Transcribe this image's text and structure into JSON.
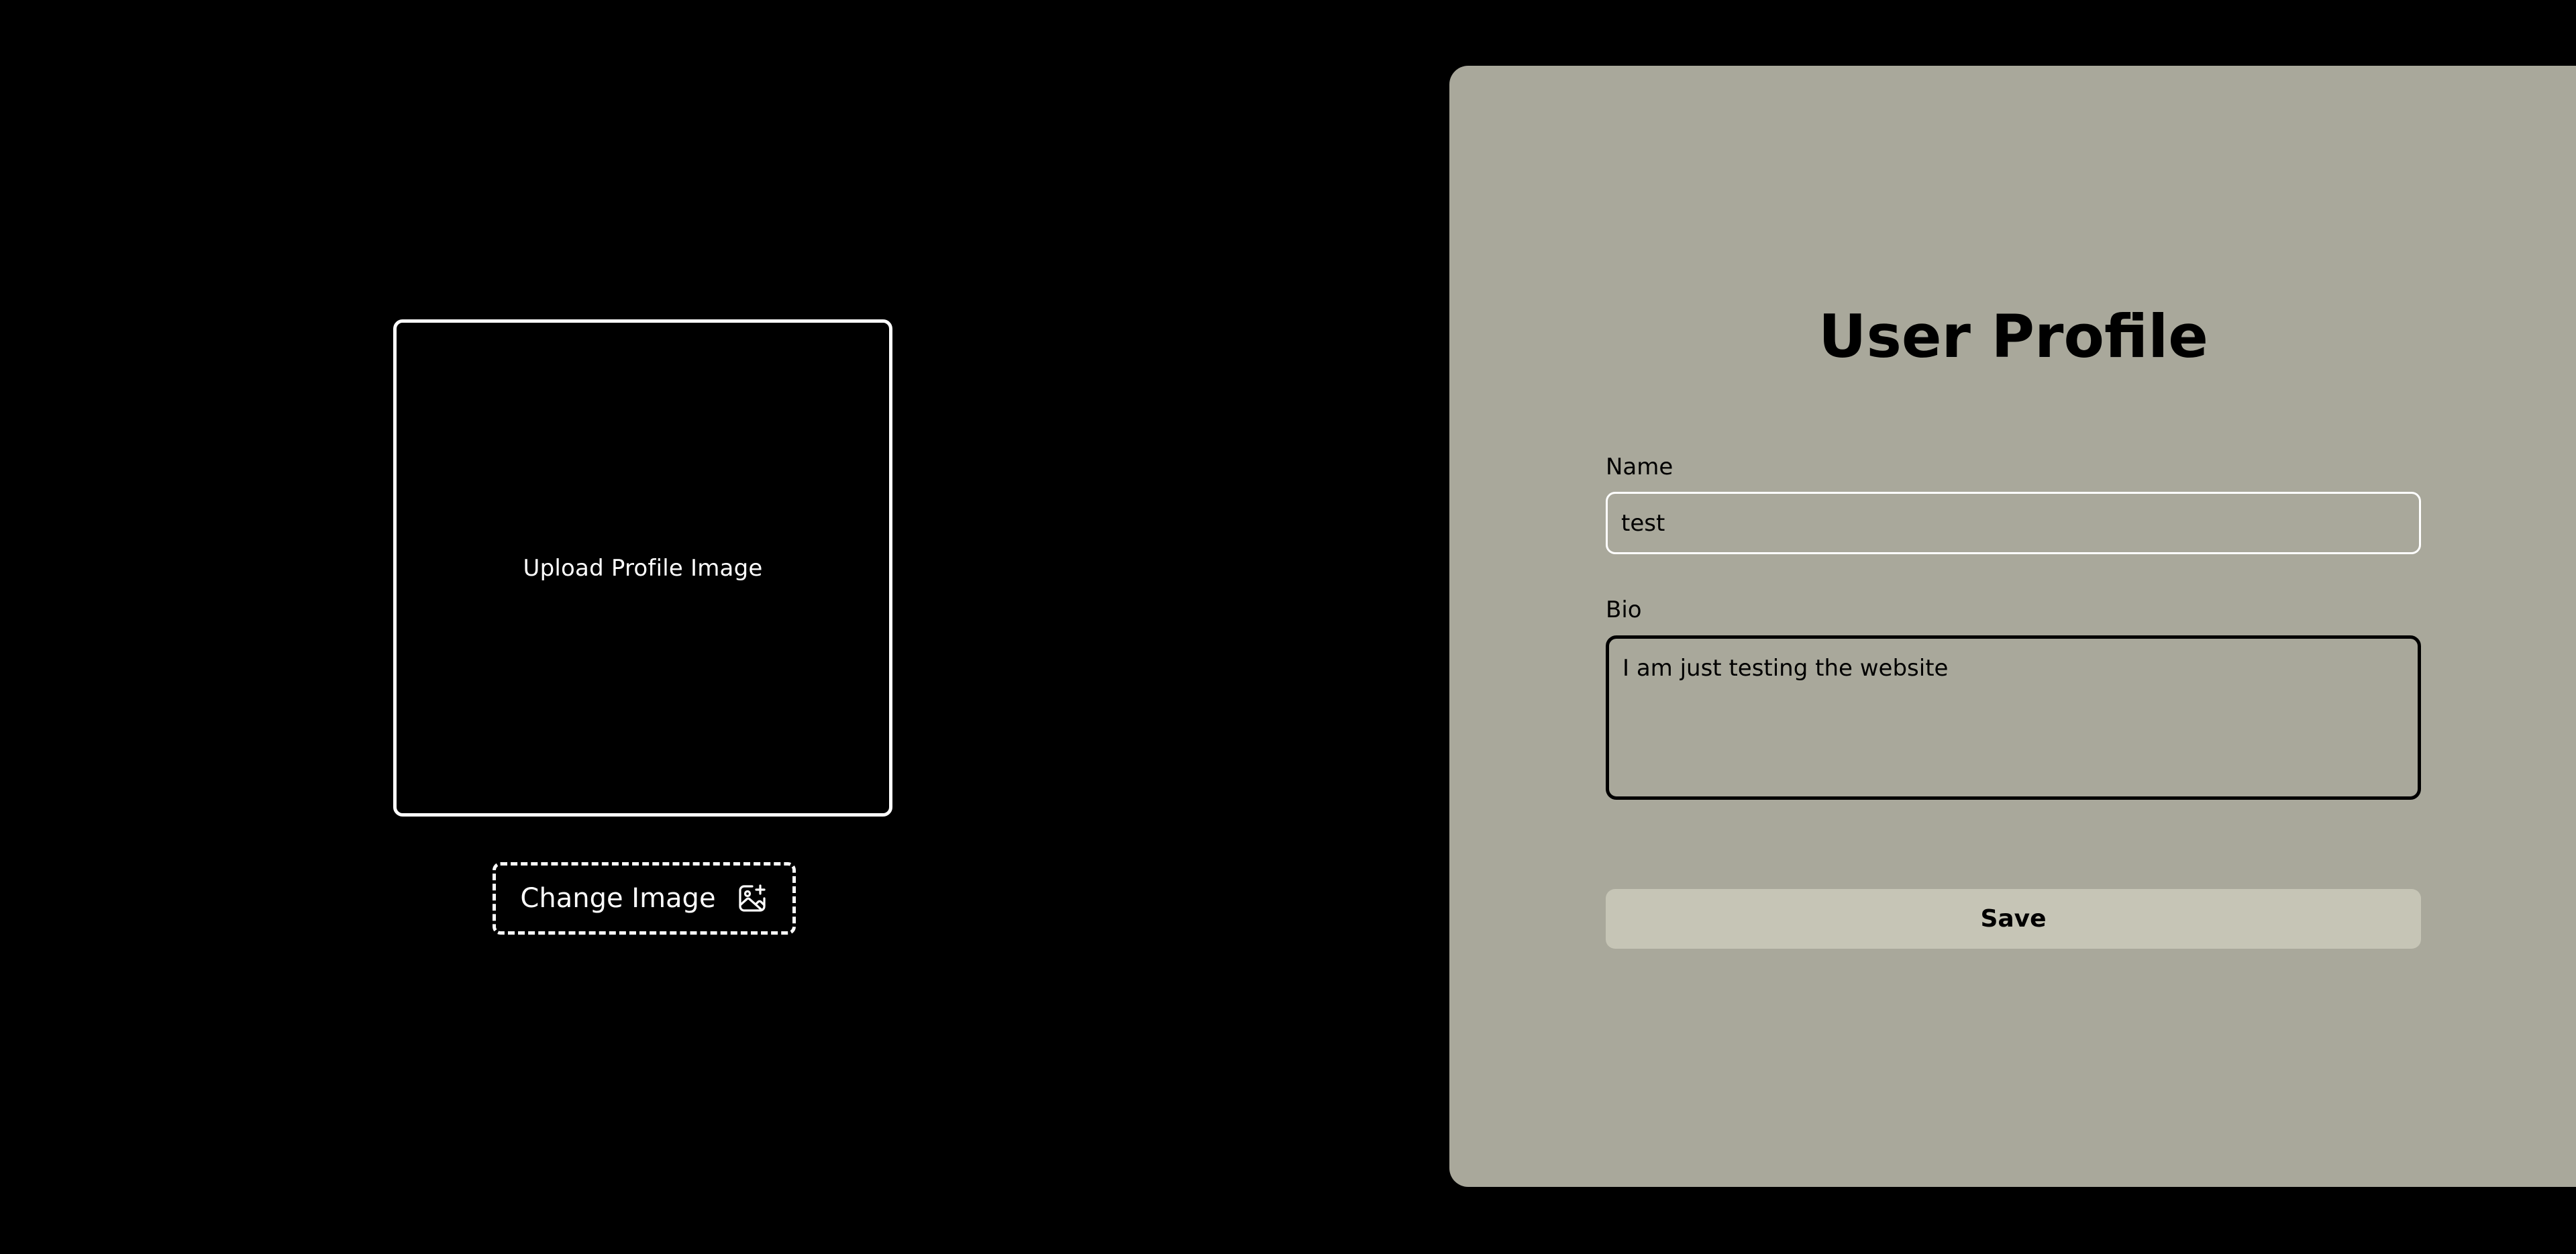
{
  "upload": {
    "label": "Upload Profile Image",
    "change_button_label": "Change Image",
    "change_icon": "image-sparkle-icon"
  },
  "profile": {
    "title": "User Profile",
    "name_label": "Name",
    "name_value": "test",
    "bio_label": "Bio",
    "bio_value": "I am just testing the website",
    "save_label": "Save"
  },
  "colors": {
    "page_background": "#000000",
    "card_background": "#a9a89b",
    "save_button": "#c6c5b6",
    "outline_light": "#ffffff",
    "outline_dark": "#000000"
  }
}
